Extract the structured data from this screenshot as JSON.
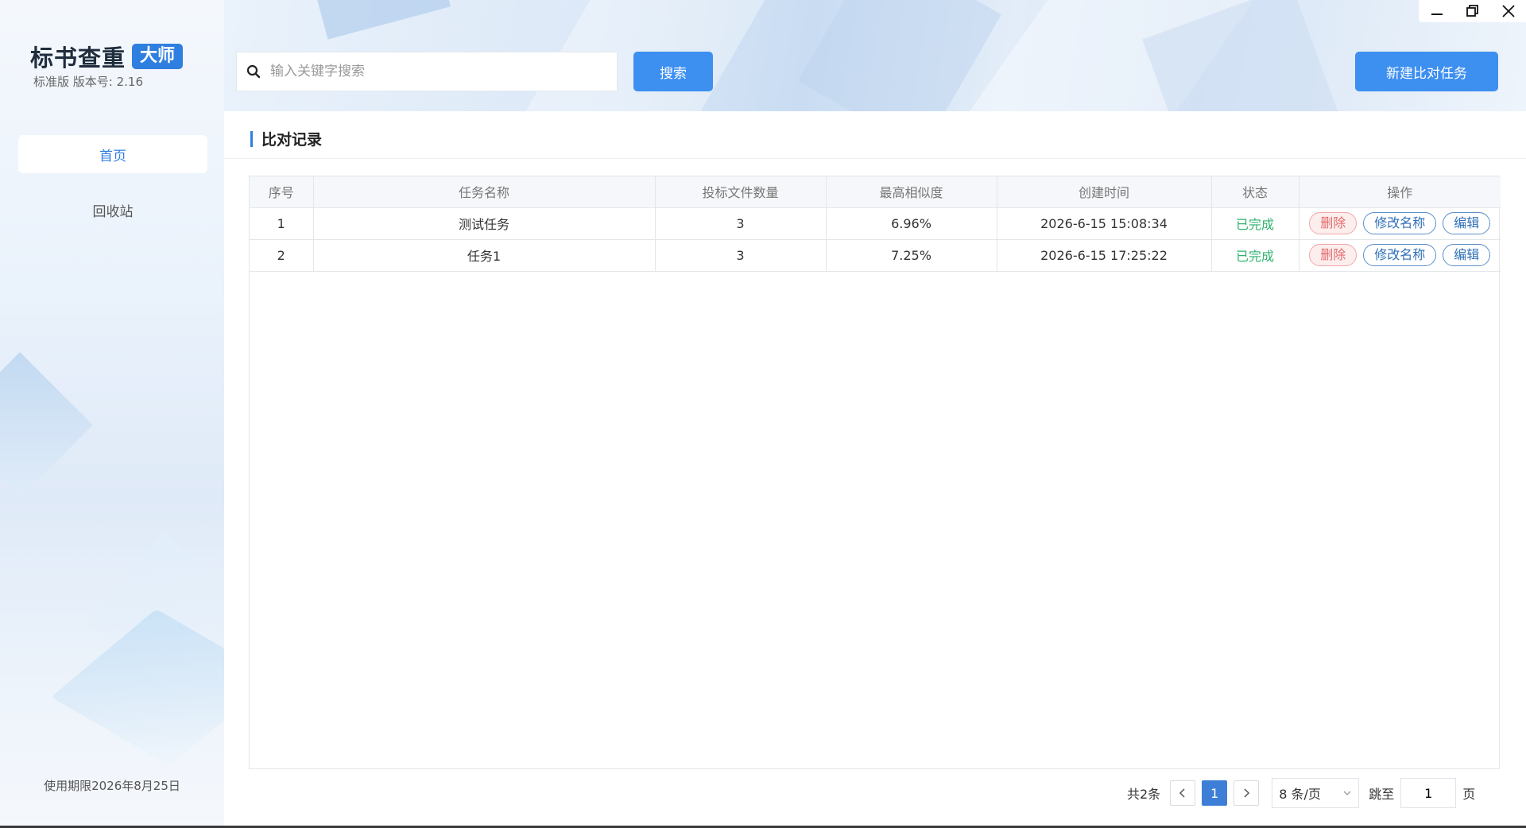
{
  "app": {
    "title": "标书查重",
    "badge": "大师",
    "version": "标准版 版本号: 2.16",
    "expiry": "使用期限2026年8月25日"
  },
  "sidebar": {
    "items": [
      {
        "label": "首页",
        "active": true
      },
      {
        "label": "回收站",
        "active": false
      }
    ]
  },
  "search": {
    "placeholder": "输入关键字搜索",
    "value": "",
    "button_label": "搜索"
  },
  "toolbar": {
    "new_task_label": "新建比对任务"
  },
  "window_controls": [
    "minimize-icon",
    "restore-icon",
    "close-icon"
  ],
  "section": {
    "title": "比对记录"
  },
  "table": {
    "columns": [
      "序号",
      "任务名称",
      "投标文件数量",
      "最高相似度",
      "创建时间",
      "状态",
      "操作"
    ],
    "rows": [
      {
        "index": "1",
        "name": "测试任务",
        "file_count": "3",
        "max_similarity": "6.96%",
        "created": "2026-6-15 15:08:34",
        "status": "已完成"
      },
      {
        "index": "2",
        "name": "任务1",
        "file_count": "3",
        "max_similarity": "7.25%",
        "created": "2026-6-15 17:25:22",
        "status": "已完成"
      }
    ],
    "actions": {
      "delete": "删除",
      "rename": "修改名称",
      "edit": "编辑"
    }
  },
  "pagination": {
    "total": "共2条",
    "current_page": "1",
    "page_size": "8 条/页",
    "jump_label": "跳至",
    "jump_value": "1",
    "page_suffix": "页"
  },
  "colors": {
    "primary": "#3d8ff0",
    "brand_badge": "#2f7fe0",
    "status_done": "#2fb36f",
    "delete": "#e26b6b"
  }
}
